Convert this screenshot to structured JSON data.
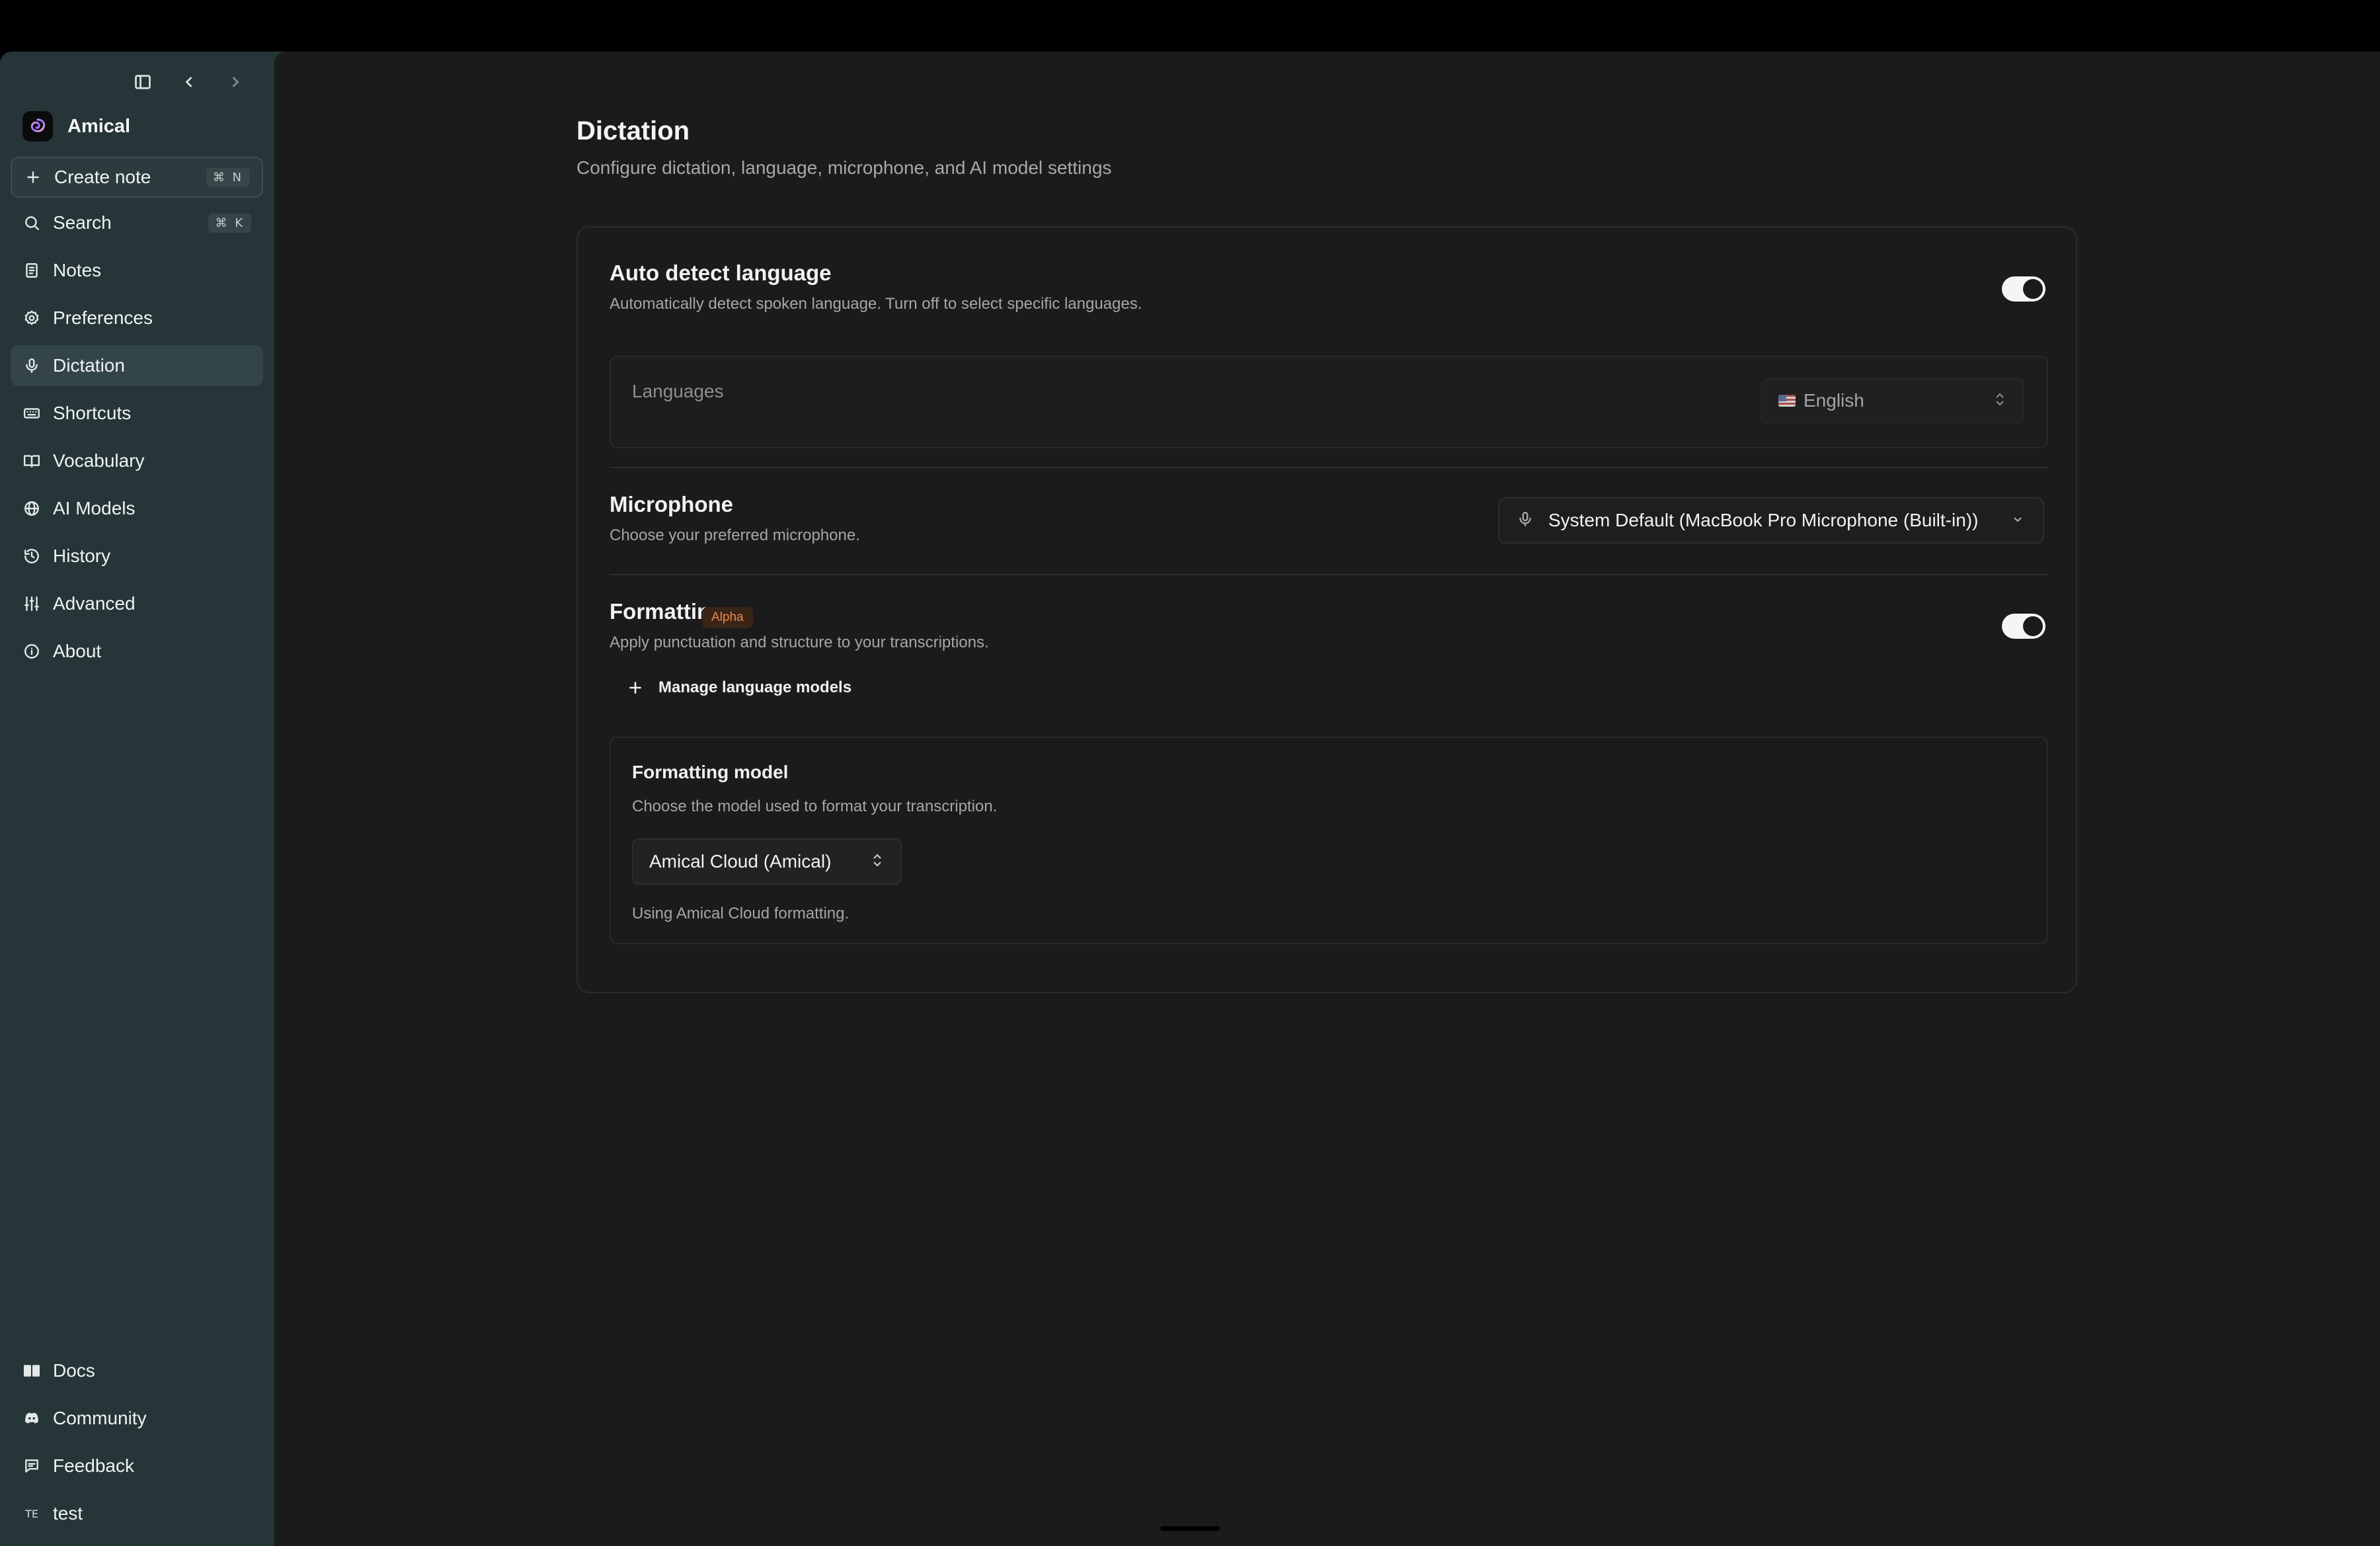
{
  "app": {
    "name": "Amical"
  },
  "sidebar": {
    "create_note": {
      "label": "Create note",
      "shortcut": "⌘ N"
    },
    "items": [
      {
        "label": "Search",
        "icon": "search-icon",
        "shortcut": "⌘ K"
      },
      {
        "label": "Notes",
        "icon": "notes-icon"
      },
      {
        "label": "Preferences",
        "icon": "gear-icon"
      },
      {
        "label": "Dictation",
        "icon": "mic-icon",
        "active": true
      },
      {
        "label": "Shortcuts",
        "icon": "keyboard-icon"
      },
      {
        "label": "Vocabulary",
        "icon": "book-icon"
      },
      {
        "label": "AI Models",
        "icon": "globe-icon"
      },
      {
        "label": "History",
        "icon": "history-icon"
      },
      {
        "label": "Advanced",
        "icon": "sliders-icon"
      },
      {
        "label": "About",
        "icon": "info-icon"
      }
    ],
    "bottom_items": [
      {
        "label": "Docs",
        "icon": "book-open-icon"
      },
      {
        "label": "Community",
        "icon": "discord-icon"
      },
      {
        "label": "Feedback",
        "icon": "feedback-icon"
      },
      {
        "label": "test",
        "avatar": "TE"
      }
    ]
  },
  "page": {
    "title": "Dictation",
    "subtitle": "Configure dictation, language, microphone, and AI model settings"
  },
  "auto_detect": {
    "title": "Auto detect language",
    "desc": "Automatically detect spoken language. Turn off to select specific languages.",
    "enabled": true
  },
  "languages": {
    "label": "Languages",
    "value": "English"
  },
  "microphone": {
    "title": "Microphone",
    "desc": "Choose your preferred microphone.",
    "value": "System Default (MacBook Pro Microphone (Built-in))"
  },
  "formatting": {
    "title": "Formatting",
    "badge": "Alpha",
    "desc": "Apply punctuation and structure to your transcriptions.",
    "enabled": true,
    "manage_label": "Manage language models",
    "model": {
      "title": "Formatting model",
      "desc": "Choose the model used to format your transcription.",
      "value": "Amical Cloud (Amical)",
      "note": "Using Amical Cloud formatting."
    }
  },
  "colors": {
    "accent_badge": "#e88a4d",
    "sidebar_bg": "#253538",
    "main_bg": "#1b1b1b"
  }
}
